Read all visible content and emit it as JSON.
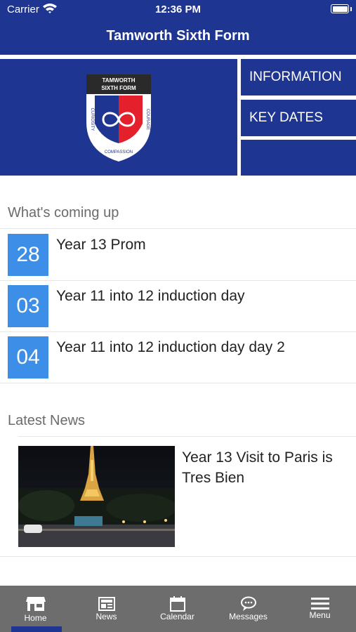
{
  "status_bar": {
    "carrier": "Carrier",
    "time": "12:36 PM"
  },
  "app": {
    "title": "Tamworth Sixth Form"
  },
  "logo": {
    "line1": "TAMWORTH",
    "line2": "SIXTH FORM",
    "left_text": "CURIOSITY",
    "right_text": "COURAGE",
    "bottom_text": "COMPASSION"
  },
  "tiles": {
    "information": "INFORMATION",
    "key_dates": "KEY DATES"
  },
  "coming_up": {
    "title": "What's coming up",
    "events": [
      {
        "day": "28",
        "title": "Year 13 Prom"
      },
      {
        "day": "03",
        "title": "Year 11 into 12 induction day"
      },
      {
        "day": "04",
        "title": "Year 11 into 12 induction day day 2"
      }
    ]
  },
  "latest_news": {
    "title": "Latest News",
    "items": [
      {
        "headline": "Year 13 Visit to Paris is Tres Bien"
      }
    ]
  },
  "tabbar": {
    "tabs": [
      {
        "label": "Home",
        "icon": "home-store-icon"
      },
      {
        "label": "News",
        "icon": "newspaper-icon"
      },
      {
        "label": "Calendar",
        "icon": "calendar-icon"
      },
      {
        "label": "Messages",
        "icon": "chat-bubble-icon"
      },
      {
        "label": "Menu",
        "icon": "hamburger-menu-icon"
      }
    ],
    "active": "Home"
  },
  "colors": {
    "brand_navy": "#1f3592",
    "date_badge_blue": "#3d8ee6",
    "tabbar_gray": "#6d6d6d",
    "logo_red": "#e3202b"
  }
}
